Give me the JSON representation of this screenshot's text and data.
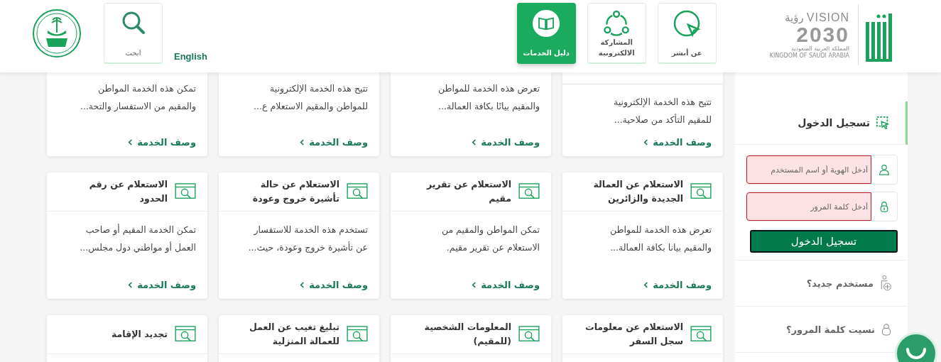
{
  "header": {
    "vision": {
      "word": "VISION",
      "arabic": "رؤية",
      "year": "2030",
      "country_ar": "المملكة العربية السعودية",
      "country_en": "KINGDOM OF SAUDI ARABIA"
    },
    "nav": [
      {
        "label": "عن أبشر",
        "kind": "about",
        "selected": false
      },
      {
        "label": "المشاركة الالكترونية",
        "kind": "share",
        "selected": false
      },
      {
        "label": "دليل الخدمات",
        "kind": "guide",
        "selected": true
      }
    ],
    "language": "English",
    "search": {
      "label": "ابحث"
    }
  },
  "rows": [
    {
      "cards": [
        {
          "lines": [
            "تتيح هذه الخدمة الإلكترونية",
            "للمقيم التأكد من صلاحية..."
          ],
          "link": "وصف الخدمة"
        },
        {
          "lines": [
            "تعرض هذه الخدمة للمواطن",
            "والمقيم بيانًا بكافة العمالة..."
          ],
          "link": "وصف الخدمة"
        },
        {
          "lines": [
            "تتيح هذه الخدمة الإلكترونية",
            "للمواطن والمقيم الاستعلام ع..."
          ],
          "link": "وصف الخدمة"
        },
        {
          "lines": [
            "تمكن هذه الخدمة المواطن",
            "والمقيم من الاستفسار والتحة..."
          ],
          "link": "وصف الخدمة"
        }
      ]
    },
    {
      "cards": [
        {
          "title": "الاستعلام عن العمالة الجديدة والزائرين",
          "lines": [
            "تعرض هذه الخدمة للمواطن",
            "والمقيم بيانا بكافة العمالة..."
          ],
          "link": "وصف الخدمة"
        },
        {
          "title": "الاستعلام عن تقرير مقيم",
          "lines": [
            "تمكن المواطن والمقيم من",
            "الاستعلام عن تقرير مقيم."
          ],
          "link": "وصف الخدمة"
        },
        {
          "title": "الاستعلام عن حالة تأشيرة خروج وعودة",
          "lines": [
            "تستخدم هذه الخدمة للاستفسار",
            "عن تأشيرة خروج وعودة، حيث..."
          ],
          "link": "وصف الخدمة"
        },
        {
          "title": "الاستعلام عن رقم الحدود",
          "lines": [
            "تمكن الخدمة المقيم أو صاحب",
            "العمل أو مواطني دول مجلس..."
          ],
          "link": "وصف الخدمة"
        }
      ]
    },
    {
      "cards": [
        {
          "title": "الاستعلام عن معلومات سجل السفر"
        },
        {
          "title": "المعلومات الشخصية (للمقيم)"
        },
        {
          "title": "تبليغ تغيب عن العمل للعمالة المنزلية"
        },
        {
          "title": "تجديد الإقامة"
        }
      ]
    }
  ],
  "login": {
    "title": "تسجيل الدخول",
    "fields": [
      {
        "kind": "user",
        "placeholder": "أدخل الهوية أو اسم المستخدم",
        "error": true
      },
      {
        "kind": "password",
        "placeholder": "أدخل كلمة المرور",
        "error": true
      }
    ],
    "button": "تسجيل الدخول",
    "links": [
      {
        "kind": "new-user",
        "label": "مستخدم جديد؟"
      },
      {
        "kind": "forgot",
        "label": "نسيت كلمة المرور؟"
      }
    ]
  }
}
